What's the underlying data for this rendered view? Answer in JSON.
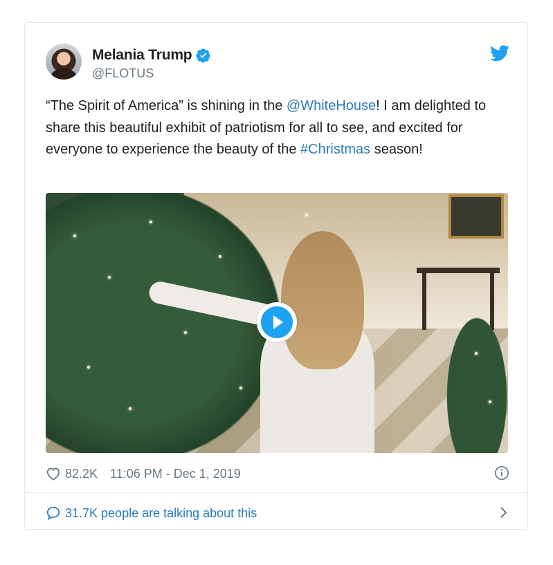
{
  "tweet": {
    "author_name": "Melania Trump",
    "handle": "@FLOTUS",
    "text_parts": {
      "p1": "“The Spirit of America” is shining in the ",
      "mention": "@WhiteHouse",
      "p2": "! I am delighted to share this beautiful exhibit of patriotism for all to see, and excited for everyone to experience the beauty of the ",
      "hashtag": "#Christmas",
      "p3": " season!"
    },
    "likes": "82.2K",
    "timestamp": "11:06 PM - Dec 1, 2019",
    "talking": "31.7K people are talking about this"
  },
  "icons": {
    "verified": "verified-badge-icon",
    "brand": "twitter-bird-icon",
    "heart": "heart-icon",
    "info": "info-icon",
    "play": "play-icon",
    "comment": "comment-bubble-icon",
    "chevron": "chevron-right-icon"
  },
  "colors": {
    "accent": "#1da1f2",
    "link": "#2b7bb9",
    "muted": "#697882",
    "border": "#e1e8ed"
  }
}
